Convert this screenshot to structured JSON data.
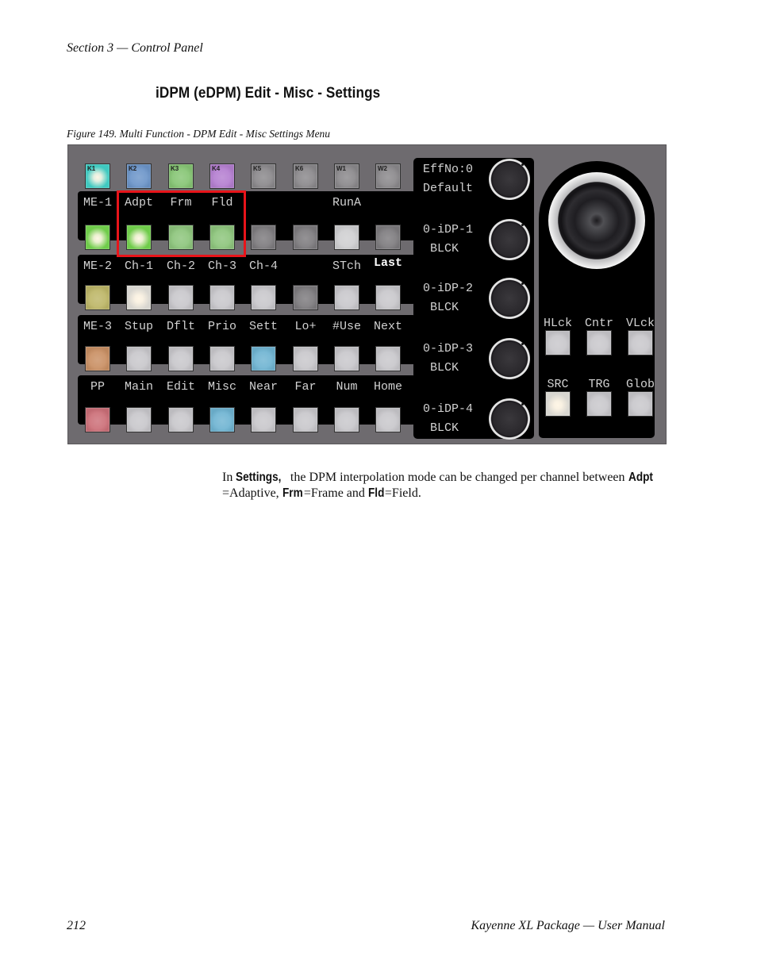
{
  "header": {
    "running_title": "Section 3 — Control Panel"
  },
  "section_title": "iDPM (eDPM) Edit - Misc - Settings",
  "figure_caption": "Figure 149.  Multi Function - DPM Edit - Misc Settings Menu",
  "panel": {
    "top_buttons": [
      {
        "label": "K1",
        "color": "#3fc9c0",
        "lit": true
      },
      {
        "label": "K2",
        "color": "#6c95c9",
        "lit": false
      },
      {
        "label": "K3",
        "color": "#86c574",
        "lit": false
      },
      {
        "label": "K4",
        "color": "#b47ed0",
        "lit": false
      },
      {
        "label": "K5",
        "color": "#8a888b",
        "lit": false
      },
      {
        "label": "K6",
        "color": "#8a888b",
        "lit": false
      },
      {
        "label": "W1",
        "color": "#8a888b",
        "lit": false
      },
      {
        "label": "W2",
        "color": "#8a888b",
        "lit": false
      }
    ],
    "rows": [
      {
        "labels": [
          "ME-1",
          "Adpt",
          "Frm",
          "Fld",
          "",
          "",
          "RunA",
          ""
        ],
        "buttons": [
          {
            "color": "#6fcc4a",
            "lit": true
          },
          {
            "color": "#6fcc4a",
            "lit": true
          },
          {
            "color": "#8dc57c",
            "lit": false
          },
          {
            "color": "#8dc57c",
            "lit": false
          },
          {
            "color": "#7d7b7e",
            "lit": false
          },
          {
            "color": "#7d7b7e",
            "lit": false
          },
          {
            "color": "#cfcfd1",
            "lit": false
          },
          {
            "color": "#7d7b7e",
            "lit": false
          }
        ]
      },
      {
        "labels": [
          "ME-2",
          "Ch-1",
          "Ch-2",
          "Ch-3",
          "Ch-4",
          "",
          "STch",
          "Last"
        ],
        "bold_label_index": 7,
        "buttons": [
          {
            "color": "#bdb667",
            "lit": false
          },
          {
            "color": "#d8d6d0",
            "lit": true
          },
          {
            "color": "#c8c7cb",
            "lit": false
          },
          {
            "color": "#c8c7cb",
            "lit": false
          },
          {
            "color": "#c8c7cb",
            "lit": false
          },
          {
            "color": "#7d7b7e",
            "lit": false
          },
          {
            "color": "#c8c7cb",
            "lit": false
          },
          {
            "color": "#c8c7cb",
            "lit": false
          }
        ]
      },
      {
        "labels": [
          "ME-3",
          "Stup",
          "Dflt",
          "Prio",
          "Sett",
          "Lo+",
          "#Use",
          "Next"
        ],
        "buttons": [
          {
            "color": "#c98f63",
            "lit": false
          },
          {
            "color": "#c8c7cb",
            "lit": false
          },
          {
            "color": "#c8c7cb",
            "lit": false
          },
          {
            "color": "#c8c7cb",
            "lit": false
          },
          {
            "color": "#6fb4d2",
            "lit": false
          },
          {
            "color": "#c8c7cb",
            "lit": false
          },
          {
            "color": "#c8c7cb",
            "lit": false
          },
          {
            "color": "#c8c7cb",
            "lit": false
          }
        ]
      },
      {
        "labels": [
          "PP",
          "Main",
          "Edit",
          "Misc",
          "Near",
          "Far",
          "Num",
          "Home"
        ],
        "buttons": [
          {
            "color": "#cc6f78",
            "lit": false
          },
          {
            "color": "#c8c7cb",
            "lit": false
          },
          {
            "color": "#c8c7cb",
            "lit": false
          },
          {
            "color": "#6fb4d2",
            "lit": false
          },
          {
            "color": "#c8c7cb",
            "lit": false
          },
          {
            "color": "#c8c7cb",
            "lit": false
          },
          {
            "color": "#c8c7cb",
            "lit": false
          },
          {
            "color": "#c8c7cb",
            "lit": false
          }
        ]
      }
    ],
    "knobs": [
      {
        "line1": "EffNo:0",
        "line2": "Default"
      },
      {
        "line1": "0-iDP-1",
        "line2": " BLCK"
      },
      {
        "line1": "0-iDP-2",
        "line2": " BLCK"
      },
      {
        "line1": "0-iDP-3",
        "line2": " BLCK"
      },
      {
        "line1": "0-iDP-4",
        "line2": " BLCK"
      }
    ],
    "joystick_rows": [
      {
        "labels": [
          "HLck",
          "Cntr",
          "VLck"
        ],
        "buttons": [
          {
            "color": "#c8c7cb",
            "lit": false
          },
          {
            "color": "#c8c7cb",
            "lit": false
          },
          {
            "color": "#c8c7cb",
            "lit": false
          }
        ]
      },
      {
        "labels": [
          "SRC",
          "TRG",
          "Glob"
        ],
        "buttons": [
          {
            "color": "#d8d6d0",
            "lit": true
          },
          {
            "color": "#c8c7cb",
            "lit": false
          },
          {
            "color": "#c8c7cb",
            "lit": false
          }
        ]
      }
    ],
    "highlight_color": "#e8141a"
  },
  "body": {
    "t1": "In ",
    "kw_settings": "Settings,",
    "t2": " the DPM interpolation mode can be changed per channel between ",
    "kw_adpt": "Adpt",
    "t3": "=Adaptive, ",
    "kw_frm": "Frm",
    "t4": "=Frame and ",
    "kw_fld": "Fld",
    "t5": "=Field."
  },
  "footer": {
    "page_number": "212",
    "title": "Kayenne XL Package  —  User Manual"
  }
}
